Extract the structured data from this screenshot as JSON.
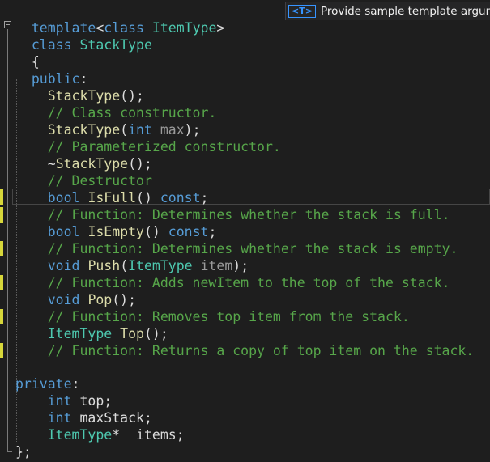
{
  "template_hint": {
    "badge": "<T>",
    "text": "Provide sample template argum"
  },
  "code": {
    "line1": {
      "template": "template",
      "lt": "<",
      "class": "class",
      "itemtype": "ItemType",
      "gt": ">"
    },
    "line2": {
      "class": "class",
      "name": "StackType"
    },
    "line3": "{",
    "line4": {
      "public": "public",
      "colon": ":"
    },
    "line6": {
      "ctor": "StackType",
      "rest": "();"
    },
    "line7": "// Class constructor.",
    "line8": {
      "ctor": "StackType",
      "open": "(",
      "int": "int",
      "sp": " ",
      "max": "max",
      "rest": ");"
    },
    "line9": "// Parameterized constructor.",
    "line10": {
      "tilde": "~",
      "dtor": "StackType",
      "rest": "();"
    },
    "line11": "// Destructor",
    "line12": {
      "bool": "bool",
      "sp": " ",
      "fn": "IsFull",
      "paren": "() ",
      "const": "const",
      "semi": ";"
    },
    "line13": "// Function: Determines whether the stack is full.",
    "line14": {
      "bool": "bool",
      "sp": " ",
      "fn": "IsEmpty",
      "paren": "() ",
      "const": "const",
      "semi": ";"
    },
    "line15": "// Function: Determines whether the stack is empty.",
    "line16": {
      "void": "void",
      "sp": " ",
      "fn": "Push",
      "open": "(",
      "type": "ItemType",
      "sp2": " ",
      "param": "item",
      "rest": ");"
    },
    "line17": "// Function: Adds newItem to the top of the stack.",
    "line18": {
      "void": "void",
      "sp": " ",
      "fn": "Pop",
      "rest": "();"
    },
    "line19": "// Function: Removes top item from the stack.",
    "line20": {
      "type": "ItemType",
      "sp": " ",
      "fn": "Top",
      "rest": "();"
    },
    "line21": "// Function: Returns a copy of top item on the stack.",
    "line23": {
      "private": "private",
      "colon": ":"
    },
    "line24": {
      "int": "int",
      "sp": " ",
      "name": "top",
      "semi": ";"
    },
    "line25": {
      "int": "int",
      "sp": " ",
      "name": "maxStack",
      "semi": ";"
    },
    "line26": {
      "type": "ItemType",
      "star": "*",
      "sp": "  ",
      "name": "items",
      "semi": ";"
    },
    "line27": "};"
  },
  "colors": {
    "background": "#1e1e1e",
    "keyword": "#569cd6",
    "type": "#4ec9b0",
    "function": "#dcdcaa",
    "parameter": "#9a9a9a",
    "comment": "#57a64a",
    "plain": "#dcdcdc",
    "change_marker": "#d7d73a"
  }
}
